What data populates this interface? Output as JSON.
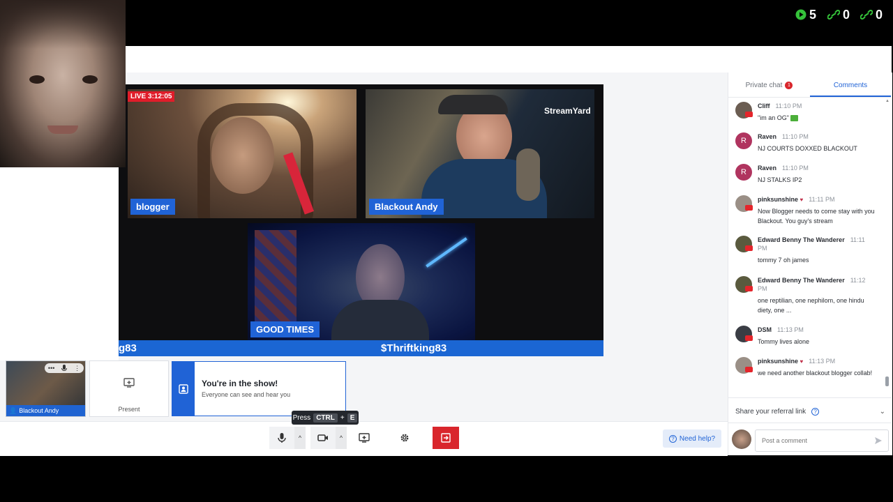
{
  "overlay_stats": [
    {
      "icon": "play-icon",
      "value": "5",
      "color": "#35c23a"
    },
    {
      "icon": "link-icon",
      "value": "0",
      "color": "#35c23a"
    },
    {
      "icon": "link-icon",
      "value": "0",
      "color": "#35c23a"
    }
  ],
  "stage": {
    "live_badge": "LIVE 3:12:05",
    "participants": [
      {
        "name": "blogger"
      },
      {
        "name": "Blackout Andy"
      },
      {
        "name": "GOOD TIMES"
      }
    ],
    "watermark": "StreamYard",
    "ticker_left": "g83",
    "ticker_center": "$Thriftking83"
  },
  "self_thumb": {
    "name": "Blackout Andy"
  },
  "present": {
    "label": "Present"
  },
  "show_card": {
    "title": "You're in the show!",
    "subtitle": "Everyone can see and hear you"
  },
  "tooltip": {
    "press": "Press",
    "key1": "CTRL",
    "plus": "+",
    "key2": "E"
  },
  "help_button": {
    "label": "Need help?"
  },
  "tabs": {
    "private_chat": "Private chat",
    "private_badge": "1",
    "comments": "Comments"
  },
  "comments": [
    {
      "name": "Cliff",
      "time": "11:10 PM",
      "text": "\"im an OG\"",
      "avatar_color": "#6b5d52"
    },
    {
      "name": "Raven",
      "time": "11:10 PM",
      "text": "NJ COURTS DOXXED BLACKOUT",
      "avatar_letter": "R",
      "avatar_color": "#b0345f"
    },
    {
      "name": "Raven",
      "time": "11:10 PM",
      "text": "NJ STALKS IP2",
      "avatar_letter": "R",
      "avatar_color": "#b0345f"
    },
    {
      "name": "pinksunshine",
      "time": "11:11 PM",
      "text": "Now Blogger needs to come stay with you Blackout. You guy's stream",
      "avatar_color": "#9a8f86"
    },
    {
      "name": "Edward Benny The Wanderer",
      "time": "11:11",
      "time2": "PM",
      "text": "tommy 7 oh james",
      "avatar_color": "#5a5a3e"
    },
    {
      "name": "Edward Benny The Wanderer",
      "time": "11:12",
      "time2": "PM",
      "text": "one reptilian, one nephilom, one hindu diety, one ...",
      "avatar_color": "#5a5a3e"
    },
    {
      "name": "DSM",
      "time": "11:13 PM",
      "text": "Tommy lives alone",
      "avatar_color": "#3a3d44"
    },
    {
      "name": "pinksunshine",
      "time": "11:13 PM",
      "text": "we need another blackout blogger collab!",
      "avatar_color": "#9a8f86"
    }
  ],
  "referral": {
    "label": "Share your referral link"
  },
  "post_comment": {
    "placeholder": "Post a comment"
  }
}
